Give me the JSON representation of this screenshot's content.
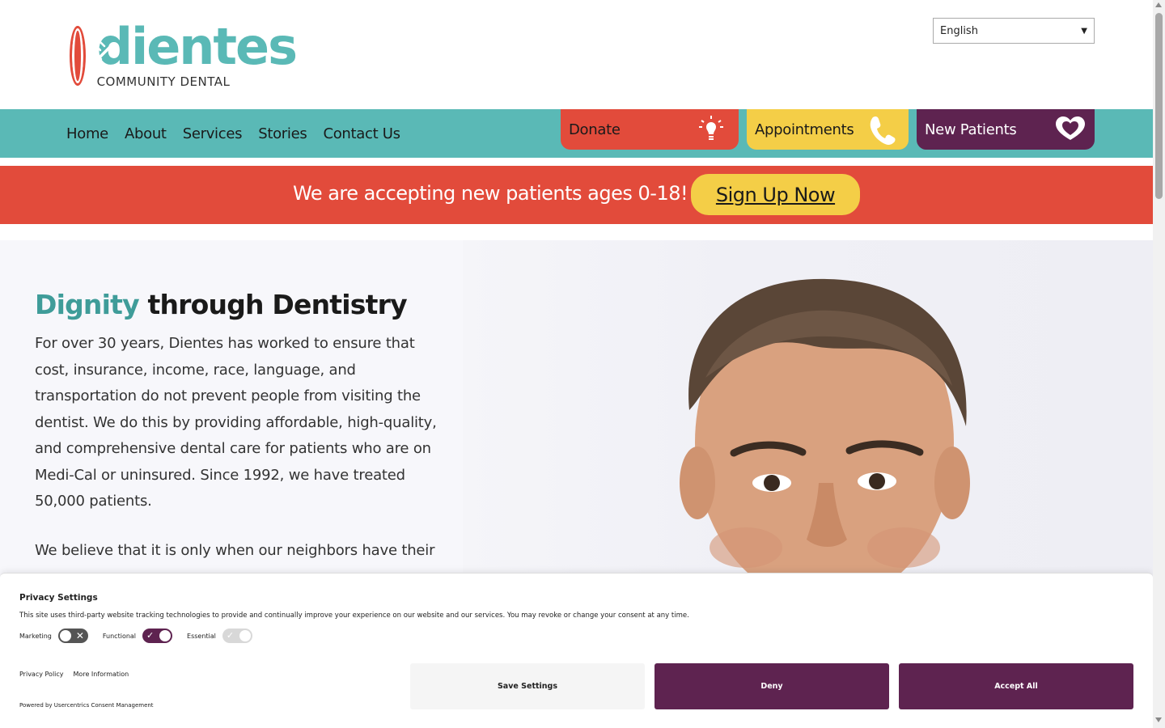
{
  "brand": {
    "name": "dientes",
    "tagline": "COMMUNITY DENTAL",
    "primary_color": "#5ab9b6",
    "red": "#e24b3b",
    "yellow": "#f4ce47",
    "purple": "#5e2350"
  },
  "language_select": {
    "value": "English"
  },
  "nav": {
    "links": [
      "Home",
      "About",
      "Services",
      "Stories",
      "Contact Us"
    ],
    "donate_label": "Donate",
    "appointments_label": "Appointments",
    "new_patients_label": "New Patients"
  },
  "banner": {
    "text": "We are accepting new patients ages 0-18!",
    "button_label": "Sign Up Now"
  },
  "hero": {
    "title_accent": "Dignity",
    "title_rest": " through Dentistry",
    "paragraph1": "For over 30 years, Dientes has worked to ensure that cost, insurance, income, race, language, and transportation do not prevent people from visiting the dentist. We do this by providing affordable, high-quality, and comprehensive dental care for patients who are on Medi-Cal or uninsured. Since 1992, we have treated 50,000 patients.",
    "paragraph2": "We believe that it is only when our neighbors have their"
  },
  "privacy": {
    "title": "Privacy Settings",
    "description": "This site uses third-party website tracking technologies to provide and continually improve your experience on our website and our services. You may revoke or change your consent at any time.",
    "toggles": [
      {
        "label": "Marketing",
        "state": "off"
      },
      {
        "label": "Functional",
        "state": "on"
      },
      {
        "label": "Essential",
        "state": "disabled-on"
      }
    ],
    "links": [
      "Privacy Policy",
      "More Information"
    ],
    "powered_by": "Powered by Usercentrics Consent Management",
    "save_label": "Save Settings",
    "deny_label": "Deny",
    "accept_label": "Accept All"
  }
}
